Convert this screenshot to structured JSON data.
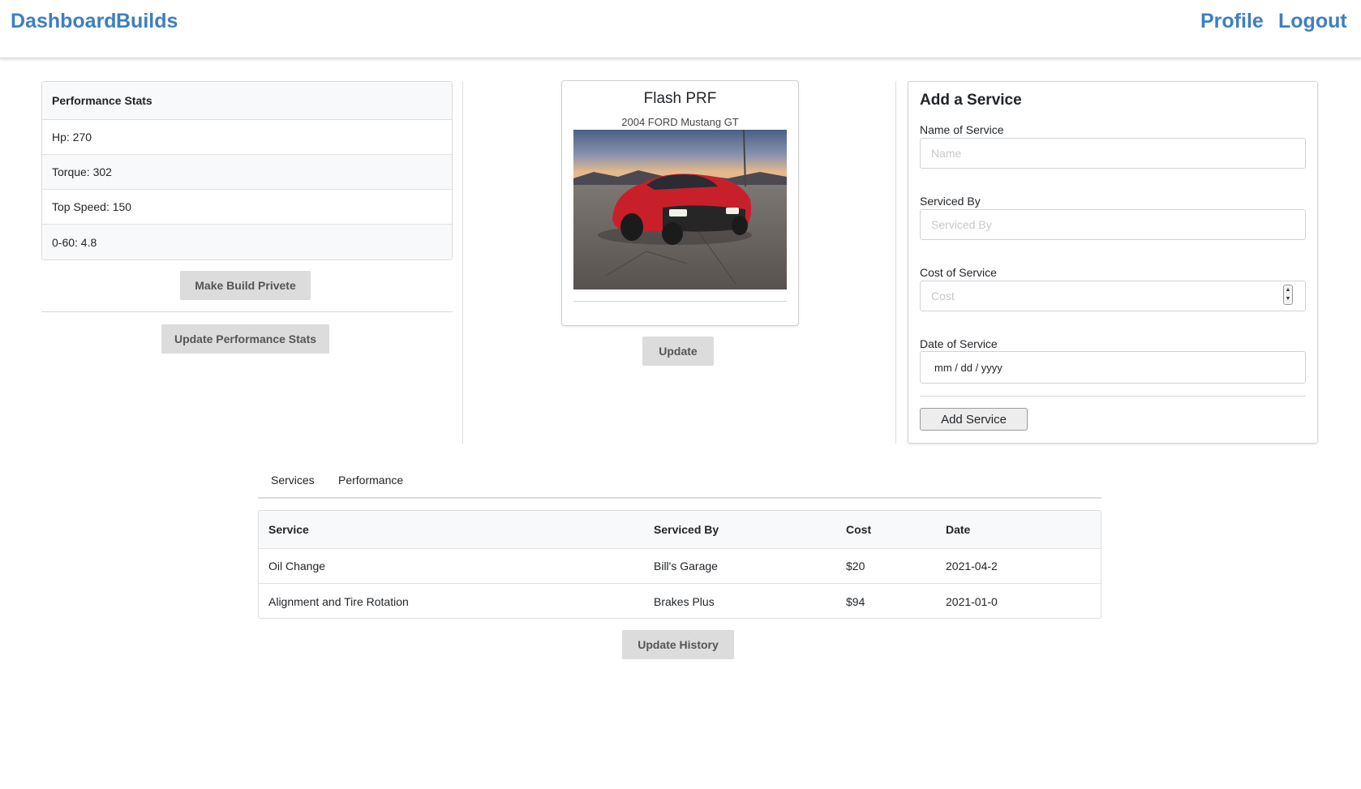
{
  "nav": {
    "dashboard": "Dashboard",
    "builds": "Builds",
    "profile": "Profile",
    "logout": "Logout",
    "link_color": "#3d7fc1"
  },
  "performance": {
    "title": "Performance Stats",
    "rows": [
      "Hp: 270",
      "Torque: 302",
      "Top Speed: 150",
      "0-60: 4.8"
    ],
    "make_private_label": "Make Build Privete",
    "update_label": "Update Performance Stats"
  },
  "build": {
    "name": "Flash PRF",
    "subtitle": "2004 FORD Mustang GT",
    "update_label": "Update",
    "car_color": "#c8202b"
  },
  "add_service": {
    "title": "Add a Service",
    "name_label": "Name of Service",
    "name_placeholder": "Name",
    "serviced_by_label": "Serviced By",
    "serviced_by_placeholder": "Serviced By",
    "cost_label": "Cost of Service",
    "cost_placeholder": "Cost",
    "date_label": "Date of Service",
    "date_placeholder": "mm / dd / yyyy",
    "submit_label": "Add Service"
  },
  "history": {
    "tabs": [
      "Services",
      "Performance"
    ],
    "columns": [
      "Service",
      "Serviced By",
      "Cost",
      "Date"
    ],
    "rows": [
      [
        "Oil Change",
        "Bill's Garage",
        "$20",
        "2021-04-2"
      ],
      [
        "Alignment and Tire Rotation",
        "Brakes Plus",
        "$94",
        "2021-01-0"
      ]
    ],
    "update_label": "Update History"
  }
}
